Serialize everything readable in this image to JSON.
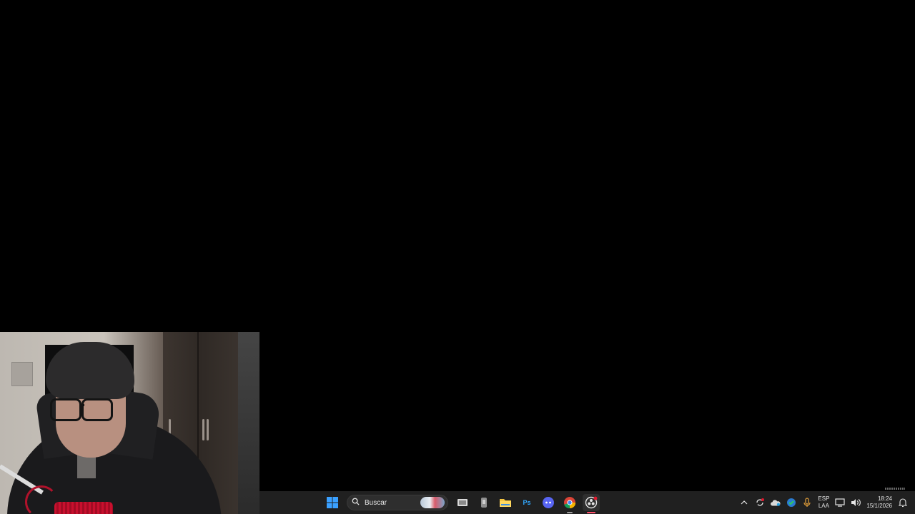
{
  "taskbar": {
    "search_placeholder": "Buscar",
    "pinned_icons": [
      "windows-start-icon",
      "search-icon",
      "task-view-icon",
      "app-icon",
      "file-explorer-icon",
      "photoshop-icon",
      "discord-icon",
      "chrome-icon",
      "obs-icon"
    ],
    "photoshop_label": "Ps",
    "tray": {
      "language_primary": "ESP",
      "language_secondary": "LAA",
      "time": "18:24",
      "date": "15/1/2026"
    }
  },
  "colors": {
    "taskbar_bg": "#202020",
    "desktop_bg": "#000000",
    "windows_blue": "#3aa0ff",
    "focused_indicator": "#ff4f6a"
  }
}
